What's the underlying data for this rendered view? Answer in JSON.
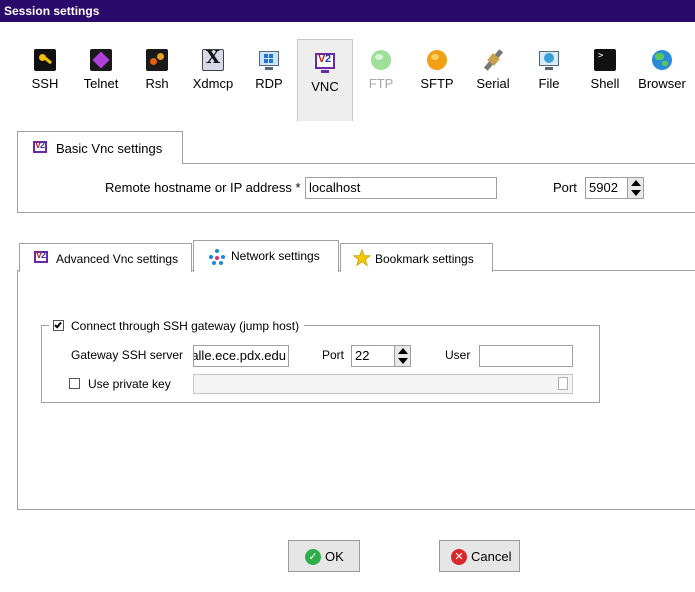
{
  "window": {
    "title": "Session settings"
  },
  "toolbar": {
    "items": [
      {
        "label": "SSH",
        "icon": "ssh-icon",
        "state": "normal"
      },
      {
        "label": "Telnet",
        "icon": "telnet-icon",
        "state": "normal"
      },
      {
        "label": "Rsh",
        "icon": "rsh-icon",
        "state": "normal"
      },
      {
        "label": "Xdmcp",
        "icon": "xdmcp-icon",
        "state": "normal"
      },
      {
        "label": "RDP",
        "icon": "rdp-icon",
        "state": "normal"
      },
      {
        "label": "VNC",
        "icon": "vnc-icon",
        "state": "selected"
      },
      {
        "label": "FTP",
        "icon": "ftp-icon",
        "state": "disabled"
      },
      {
        "label": "SFTP",
        "icon": "sftp-icon",
        "state": "normal"
      },
      {
        "label": "Serial",
        "icon": "serial-icon",
        "state": "normal"
      },
      {
        "label": "File",
        "icon": "file-icon",
        "state": "normal"
      },
      {
        "label": "Shell",
        "icon": "shell-icon",
        "state": "normal"
      },
      {
        "label": "Browser",
        "icon": "browser-icon",
        "state": "normal"
      }
    ]
  },
  "basic": {
    "tab_label": "Basic Vnc settings",
    "host_label": "Remote hostname or IP address *",
    "host_value": "localhost",
    "port_label": "Port",
    "port_value": "5902"
  },
  "tabs": {
    "advanced": "Advanced Vnc settings",
    "network": "Network settings",
    "bookmark": "Bookmark settings",
    "active": "network"
  },
  "network": {
    "gateway_checkbox_label": "Connect through SSH gateway (jump host)",
    "gateway_checked": true,
    "server_label": "Gateway SSH server",
    "server_value": "ralle.ece.pdx.edu",
    "port_label": "Port",
    "port_value": "22",
    "user_label": "User",
    "user_value": "",
    "private_key_label": "Use private key",
    "private_key_checked": false,
    "private_key_value": ""
  },
  "buttons": {
    "ok": "OK",
    "cancel": "Cancel"
  },
  "colors": {
    "titlebar": "#2a0a6b",
    "ok_icon": "#2eae4a",
    "cancel_icon": "#d8282b"
  }
}
